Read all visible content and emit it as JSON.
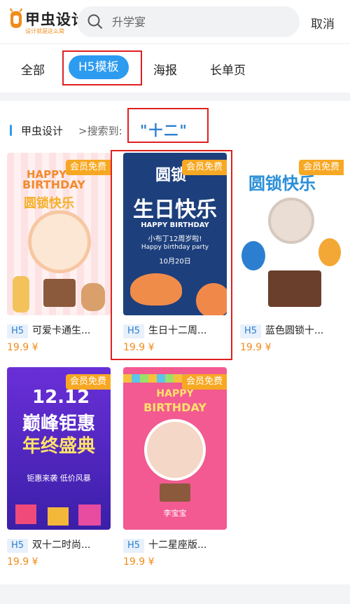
{
  "header": {
    "logo_name": "甲虫设计",
    "logo_tagline": "设计就是这么简",
    "search_placeholder": "升学宴",
    "cancel_label": "取消"
  },
  "tabs": [
    {
      "label": "全部",
      "active": false
    },
    {
      "label": "H5模板",
      "active": true
    },
    {
      "label": "海报",
      "active": false
    },
    {
      "label": "长单页",
      "active": false
    }
  ],
  "result": {
    "source": "甲虫设计",
    "prefix": ">搜索到:",
    "keyword": "\"十二\""
  },
  "cards": [
    {
      "badge": "会员免费",
      "type_tag": "H5",
      "title": "可爱卡通生...",
      "price": "19.9 ¥",
      "art": {
        "line1": "HAPPY",
        "line2": "BIRTHDAY",
        "line3": "圆锁快乐"
      }
    },
    {
      "badge": "会员免费",
      "type_tag": "H5",
      "title": "生日十二周...",
      "price": "19.9 ¥",
      "art": {
        "line1": "圆锁",
        "line2": "生日快乐",
        "line3": "HAPPY BIRTHDAY",
        "line4": "小布丁12周岁啦!",
        "line5": "Happy birthday party",
        "line6": "10月20日"
      }
    },
    {
      "badge": "会员免费",
      "type_tag": "H5",
      "title": "蓝色圆锁十...",
      "price": "19.9 ¥",
      "art": {
        "line1": "圆锁快乐"
      }
    },
    {
      "badge": "会员免费",
      "type_tag": "H5",
      "title": "双十二时尚...",
      "price": "19.9 ¥",
      "art": {
        "line1": "12.12",
        "line2": "巅峰钜惠",
        "line3": "年终盛典",
        "line4": "钜惠来袭 低价风暴"
      }
    },
    {
      "badge": "会员免费",
      "type_tag": "H5",
      "title": "十二星座版...",
      "price": "19.9 ¥",
      "art": {
        "line1": "HAPPY",
        "line2": "BIRTHDAY",
        "line3": "李宝宝"
      }
    }
  ],
  "colors": {
    "accent": "#2c9bf0",
    "badge": "#f7a823",
    "price": "#f08c1a",
    "highlight": "#e02020"
  }
}
